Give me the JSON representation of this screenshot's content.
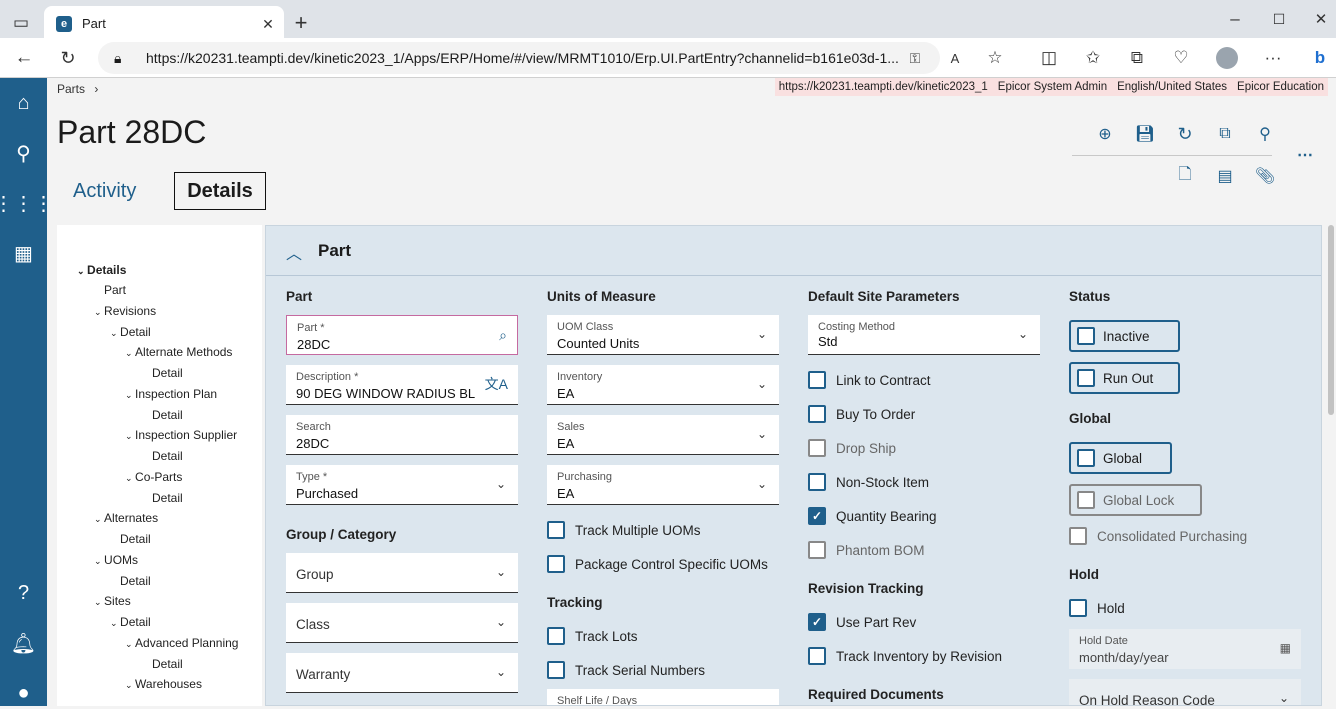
{
  "browser": {
    "tab_title": "Part",
    "url": "https://k20231.teampti.dev/kinetic2023_1/Apps/ERP/Home/#/view/MRMT1010/Erp.UI.PartEntry?channelid=b161e03d-1..."
  },
  "info": [
    "https://k20231.teampti.dev/kinetic2023_1",
    "Epicor System Admin",
    "English/United States",
    "Epicor Education"
  ],
  "breadcrumb": "Parts",
  "title": "Part 28DC",
  "tabs": {
    "activity": "Activity",
    "details": "Details"
  },
  "tree": [
    "Details",
    "Part",
    "Revisions",
    "Detail",
    "Alternate Methods",
    "Detail",
    "Inspection Plan",
    "Detail",
    "Inspection Supplier",
    "Detail",
    "Co-Parts",
    "Detail",
    "Alternates",
    "Detail",
    "UOMs",
    "Detail",
    "Sites",
    "Detail",
    "Advanced Planning",
    "Detail",
    "Warehouses"
  ],
  "panel": {
    "title": "Part"
  },
  "col1": {
    "heading": "Part",
    "part_label": "Part *",
    "part_value": "28DC",
    "desc_label": "Description *",
    "desc_value": "90 DEG WINDOW RADIUS BL...",
    "search_label": "Search",
    "search_value": "28DC",
    "type_label": "Type *",
    "type_value": "Purchased",
    "group_heading": "Group / Category",
    "group": "Group",
    "class": "Class",
    "warranty": "Warranty"
  },
  "col2": {
    "heading": "Units of Measure",
    "uom_class_label": "UOM Class",
    "uom_class_value": "Counted Units",
    "inventory_label": "Inventory",
    "inventory_value": "EA",
    "sales_label": "Sales",
    "sales_value": "EA",
    "purchasing_label": "Purchasing",
    "purchasing_value": "EA",
    "track_multiple": "Track Multiple UOMs",
    "package_control": "Package Control Specific UOMs",
    "tracking_heading": "Tracking",
    "track_lots": "Track Lots",
    "track_serial": "Track Serial Numbers",
    "shelf_life": "Shelf Life / Days"
  },
  "col3": {
    "heading": "Default Site Parameters",
    "costing_label": "Costing Method",
    "costing_value": "Std",
    "link_contract": "Link to Contract",
    "buy_to_order": "Buy To Order",
    "drop_ship": "Drop Ship",
    "non_stock": "Non-Stock Item",
    "quantity_bearing": "Quantity Bearing",
    "phantom_bom": "Phantom BOM",
    "revision_heading": "Revision Tracking",
    "use_part_rev": "Use Part Rev",
    "track_inv_rev": "Track Inventory by Revision",
    "required_docs": "Required Documents"
  },
  "col4": {
    "status_heading": "Status",
    "inactive": "Inactive",
    "run_out": "Run Out",
    "global_heading": "Global",
    "global": "Global",
    "global_lock": "Global Lock",
    "consolidated": "Consolidated Purchasing",
    "hold_heading": "Hold",
    "hold": "Hold",
    "hold_date_label": "Hold Date",
    "hold_date_value": "month/day/year",
    "hold_reason": "On Hold Reason Code"
  }
}
